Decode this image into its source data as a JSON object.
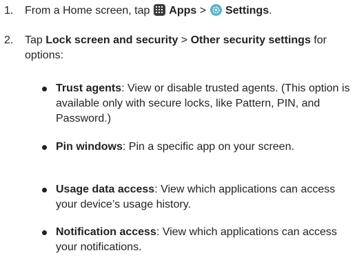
{
  "steps": [
    {
      "number": "1.",
      "prefix": "From a Home screen, tap ",
      "apps_label": "Apps",
      "separator": " > ",
      "settings_label": "Settings",
      "suffix": "."
    },
    {
      "number": "2.",
      "prefix": "Tap ",
      "lock_label": "Lock screen and security",
      "separator": " > ",
      "other_label": "Other security settings",
      "suffix": " for options:"
    }
  ],
  "options": [
    {
      "title": "Trust agents",
      "description": ": View or disable trusted agents. (This option is available only with secure locks, like Pattern, PIN, and Password.)"
    },
    {
      "title": "Pin windows",
      "description": ": Pin a specific app on your screen."
    },
    {
      "title": "Usage data access",
      "description": ": View which applications can access your device’s usage history."
    },
    {
      "title": "Notification access",
      "description": ": View which applications can access your notifications."
    }
  ],
  "icons": {
    "apps": "apps-grid-icon",
    "settings": "settings-gear-icon",
    "apps_color": "#3a3a3a",
    "settings_color": "#56b3cf"
  }
}
